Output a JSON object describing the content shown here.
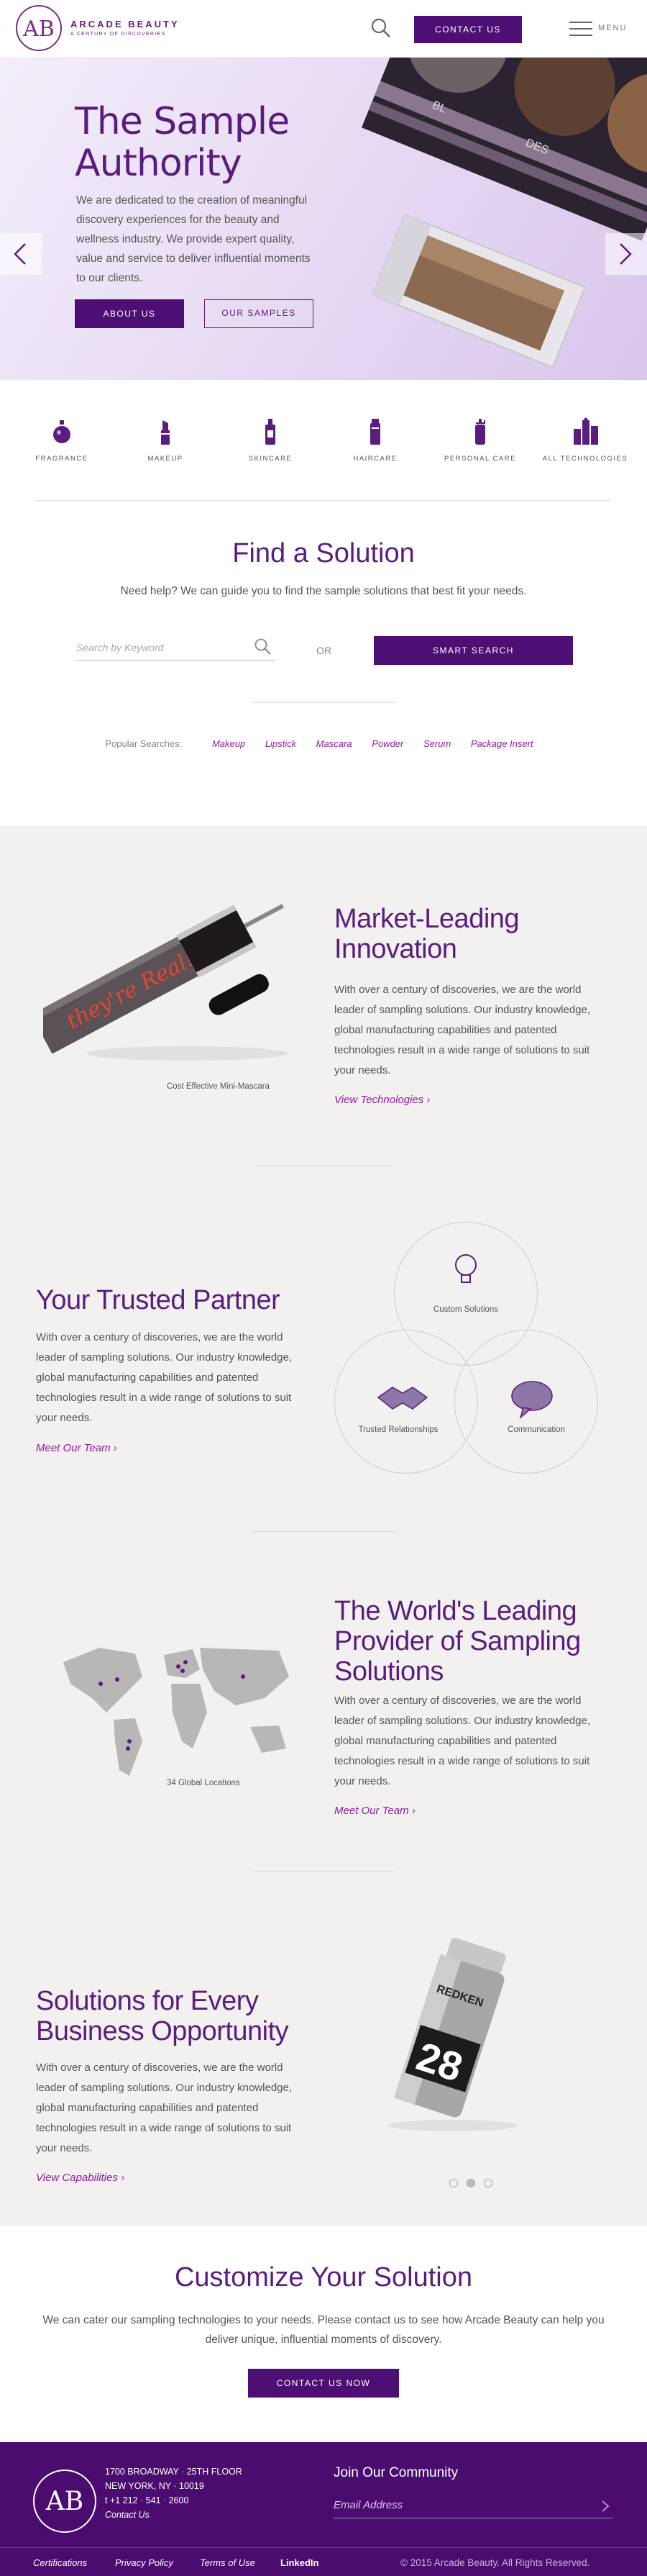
{
  "header": {
    "brand_name": "ARCADE BEAUTY",
    "brand_tagline": "A CENTURY OF DISCOVERIES",
    "contact_label": "CONTACT US",
    "menu_label": "MENU"
  },
  "hero": {
    "title_line1": "The Sample",
    "title_line2": "Authority",
    "text": "We are dedicated to the creation of meaningful discovery experiences for the beauty and wellness industry. We provide expert quality, value and service to deliver influential moments to our clients.",
    "about_label": "ABOUT US",
    "samples_label": "OUR SAMPLES"
  },
  "categories": [
    {
      "label": "FRAGRANCE",
      "icon": "fragrance-icon"
    },
    {
      "label": "MAKEUP",
      "icon": "lipstick-icon"
    },
    {
      "label": "SKINCARE",
      "icon": "skincare-icon"
    },
    {
      "label": "HAIRCARE",
      "icon": "haircare-icon"
    },
    {
      "label": "PERSONAL CARE",
      "icon": "personal-care-icon"
    },
    {
      "label": "ALL TECHNOLOGIES",
      "icon": "all-technologies-icon"
    }
  ],
  "find": {
    "title": "Find a Solution",
    "subtitle": "Need help? We can guide you to find the sample solutions that best fit your needs.",
    "search_placeholder": "Search by Keyword",
    "or_label": "OR",
    "smart_search_label": "SMART SEARCH",
    "popular_label": "Popular Searches:",
    "popular_links": [
      "Makeup",
      "Lipstick",
      "Mascara",
      "Powder",
      "Serum",
      "Package Insert"
    ]
  },
  "innovation": {
    "title_line1": "Market-Leading",
    "title_line2": "Innovation",
    "text": "With over a century of discoveries, we are the world leader of sampling solutions. Our industry knowledge, global manufacturing capabilities and patented technologies result in a wide range of solutions to suit your needs.",
    "link": "View Technologies",
    "caption": "Cost Effective Mini-Mascara",
    "mascara_text": "they're Real!"
  },
  "partner": {
    "title": "Your Trusted Partner",
    "text": "With over a century of discoveries, we are the world leader of sampling solutions. Our industry knowledge, global manufacturing capabilities and patented technologies result in a wide range of solutions to suit your needs.",
    "link": "Meet Our Team",
    "venn": [
      "Custom Solutions",
      "Trusted Relationships",
      "Communication"
    ]
  },
  "global": {
    "title_line1": "The World's Leading",
    "title_line2": "Provider of Sampling",
    "title_line3": "Solutions",
    "text": "With over a century of discoveries, we are the world leader of sampling solutions. Our industry knowledge, global manufacturing capabilities and patented technologies result in a wide range of solutions to suit your needs.",
    "link": "Meet Our Team",
    "caption": "34 Global Locations"
  },
  "business": {
    "title_line1": "Solutions for Every",
    "title_line2": "Business Opportunity",
    "text": "With over a century of discoveries, we are the world leader of sampling solutions. Our industry knowledge, global manufacturing capabilities and patented technologies result in a wide range of solutions to suit your needs.",
    "link": "View Capabilities",
    "can_brand": "REDKEN",
    "can_number": "28",
    "active_slide": 2
  },
  "customize": {
    "title": "Customize Your Solution",
    "text": "We can cater our sampling technologies to your needs. Please contact us to see how Arcade Beauty can help you deliver unique, influential moments of discovery.",
    "button": "CONTACT US NOW"
  },
  "footer": {
    "logo_text": "ARCADE BEAUTY",
    "address_line1": "1700 BROADWAY · 25TH FLOOR",
    "address_line2": "NEW YORK, NY · 10019",
    "phone": "t +1 212 · 541 · 2600",
    "contact_link": "Contact Us",
    "join_title": "Join Our Community",
    "email_placeholder": "Email Address",
    "links": [
      "Certifications",
      "Privacy Policy",
      "Terms of Use"
    ],
    "linkedin": "LinkedIn",
    "copyright": "© 2015 Arcade Beauty. All Rights Reserved."
  },
  "colors": {
    "brand_purple": "#4d0f73",
    "title_purple": "#5a1d7d",
    "link_magenta": "#8f1d9b",
    "section_gray": "#f2f1ef"
  }
}
